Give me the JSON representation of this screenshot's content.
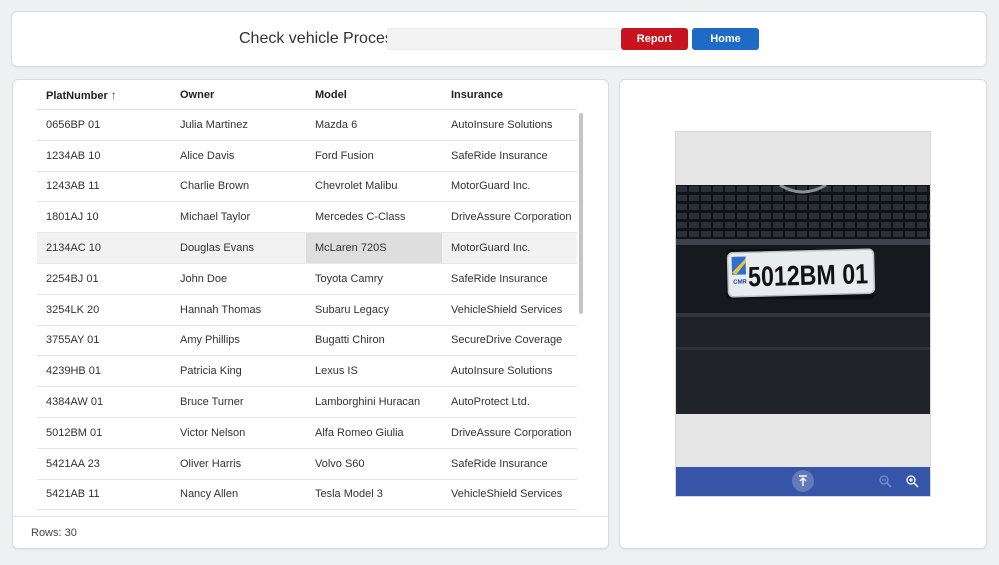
{
  "header": {
    "title": "Check vehicle Process",
    "search_value": "",
    "report_label": "Report",
    "home_label": "Home"
  },
  "table": {
    "columns": [
      "PlatNumber",
      "Owner",
      "Model",
      "Insurance"
    ],
    "sort_column": "PlatNumber",
    "sort_direction": "ascending",
    "sort_glyph": "↑",
    "rows": [
      [
        "0656BP 01",
        "Julia Martinez",
        "Mazda 6",
        "AutoInsure Solutions"
      ],
      [
        "1234AB 10",
        "Alice Davis",
        "Ford Fusion",
        "SafeRide Insurance"
      ],
      [
        "1243AB 11",
        "Charlie Brown",
        "Chevrolet Malibu",
        "MotorGuard Inc."
      ],
      [
        "1801AJ 10",
        "Michael Taylor",
        "Mercedes C-Class",
        "DriveAssure Corporation"
      ],
      [
        "2134AC 10",
        "Douglas Evans",
        "McLaren 720S",
        "MotorGuard Inc."
      ],
      [
        "2254BJ 01",
        "John Doe",
        "Toyota Camry",
        "SafeRide Insurance"
      ],
      [
        "3254LK 20",
        "Hannah Thomas",
        "Subaru Legacy",
        "VehicleShield Services"
      ],
      [
        "3755AY 01",
        "Amy Phillips",
        "Bugatti Chiron",
        "SecureDrive Coverage"
      ],
      [
        "4239HB 01",
        "Patricia King",
        "Lexus IS",
        "AutoInsure Solutions"
      ],
      [
        "4384AW 01",
        "Bruce Turner",
        "Lamborghini Huracan",
        "AutoProtect Ltd."
      ],
      [
        "5012BM 01",
        "Victor Nelson",
        "Alfa Romeo Giulia",
        "DriveAssure Corporation"
      ],
      [
        "5421AA 23",
        "Oliver Harris",
        "Volvo S60",
        "SafeRide Insurance"
      ],
      [
        "5421AB 11",
        "Nancy Allen",
        "Tesla Model 3",
        "VehicleShield Services"
      ]
    ],
    "selected_row": 4,
    "focused_cell": [
      4,
      2
    ],
    "footer": "Rows: 30"
  },
  "viewer": {
    "plate_text": "5012BM 01",
    "plate_badge": "CMR",
    "toolbar_icons": [
      "scroll-top-icon",
      "zoom-out-icon",
      "zoom-in-icon"
    ]
  },
  "colors": {
    "report": "#c8141e",
    "home": "#1d6bc4",
    "toolbar": "#3655a8"
  }
}
